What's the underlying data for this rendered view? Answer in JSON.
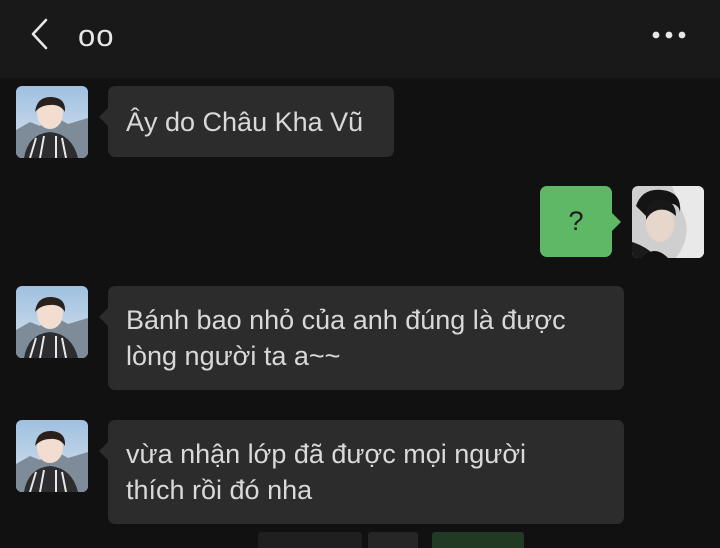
{
  "header": {
    "title": "oo",
    "back_icon": "chevron-left-icon",
    "more_icon": "ellipsis-icon"
  },
  "messages": [
    {
      "direction": "incoming",
      "text": "Ây do Châu Kha Vũ"
    },
    {
      "direction": "outgoing",
      "text": "?"
    },
    {
      "direction": "incoming",
      "text": "Bánh bao nhỏ của anh đúng là được lòng người ta a~~"
    },
    {
      "direction": "incoming",
      "text": "vừa nhận lớp đã được mọi người thích rồi đó nha"
    }
  ],
  "colors": {
    "background": "#111111",
    "header": "#191919",
    "incoming_bubble": "#2c2c2c",
    "outgoing_bubble": "#5fb865",
    "text": "#d9d9d9"
  }
}
